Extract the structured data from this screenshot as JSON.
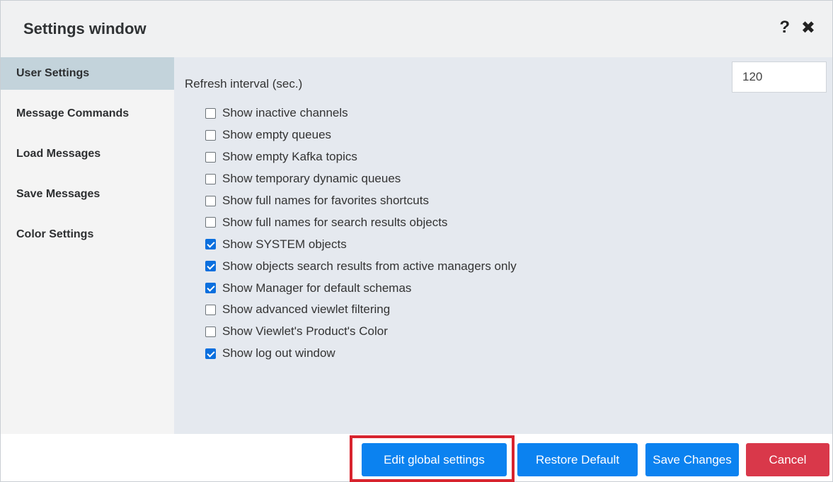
{
  "window": {
    "title": "Settings window",
    "help_icon_glyph": "?",
    "close_icon_glyph": "✖"
  },
  "sidebar": {
    "items": [
      {
        "label": "User Settings",
        "active": true
      },
      {
        "label": "Message Commands",
        "active": false
      },
      {
        "label": "Load Messages",
        "active": false
      },
      {
        "label": "Save Messages",
        "active": false
      },
      {
        "label": "Color Settings",
        "active": false
      }
    ]
  },
  "user_settings": {
    "refresh_label": "Refresh interval (sec.)",
    "refresh_value": "120",
    "options": [
      {
        "label": "Show inactive channels",
        "checked": false
      },
      {
        "label": "Show empty queues",
        "checked": false
      },
      {
        "label": "Show empty Kafka topics",
        "checked": false
      },
      {
        "label": "Show temporary dynamic queues",
        "checked": false
      },
      {
        "label": "Show full names for favorites shortcuts",
        "checked": false
      },
      {
        "label": "Show full names for search results objects",
        "checked": false
      },
      {
        "label": "Show SYSTEM objects",
        "checked": true
      },
      {
        "label": "Show objects search results from active managers only",
        "checked": true
      },
      {
        "label": "Show Manager for default schemas",
        "checked": true
      },
      {
        "label": "Show advanced viewlet filtering",
        "checked": false
      },
      {
        "label": "Show Viewlet's Product's Color",
        "checked": false
      },
      {
        "label": "Show log out window",
        "checked": true
      }
    ]
  },
  "footer": {
    "edit_global_label": "Edit global settings",
    "restore_default_label": "Restore Default",
    "save_changes_label": "Save Changes",
    "cancel_label": "Cancel"
  },
  "colors": {
    "primary": "#0b82f0",
    "danger": "#d9384a",
    "highlight": "#d8242e",
    "active_tab": "#c3d3db",
    "content_bg": "#e5e9ef"
  },
  "icons": [
    "help-icon",
    "close-icon"
  ]
}
